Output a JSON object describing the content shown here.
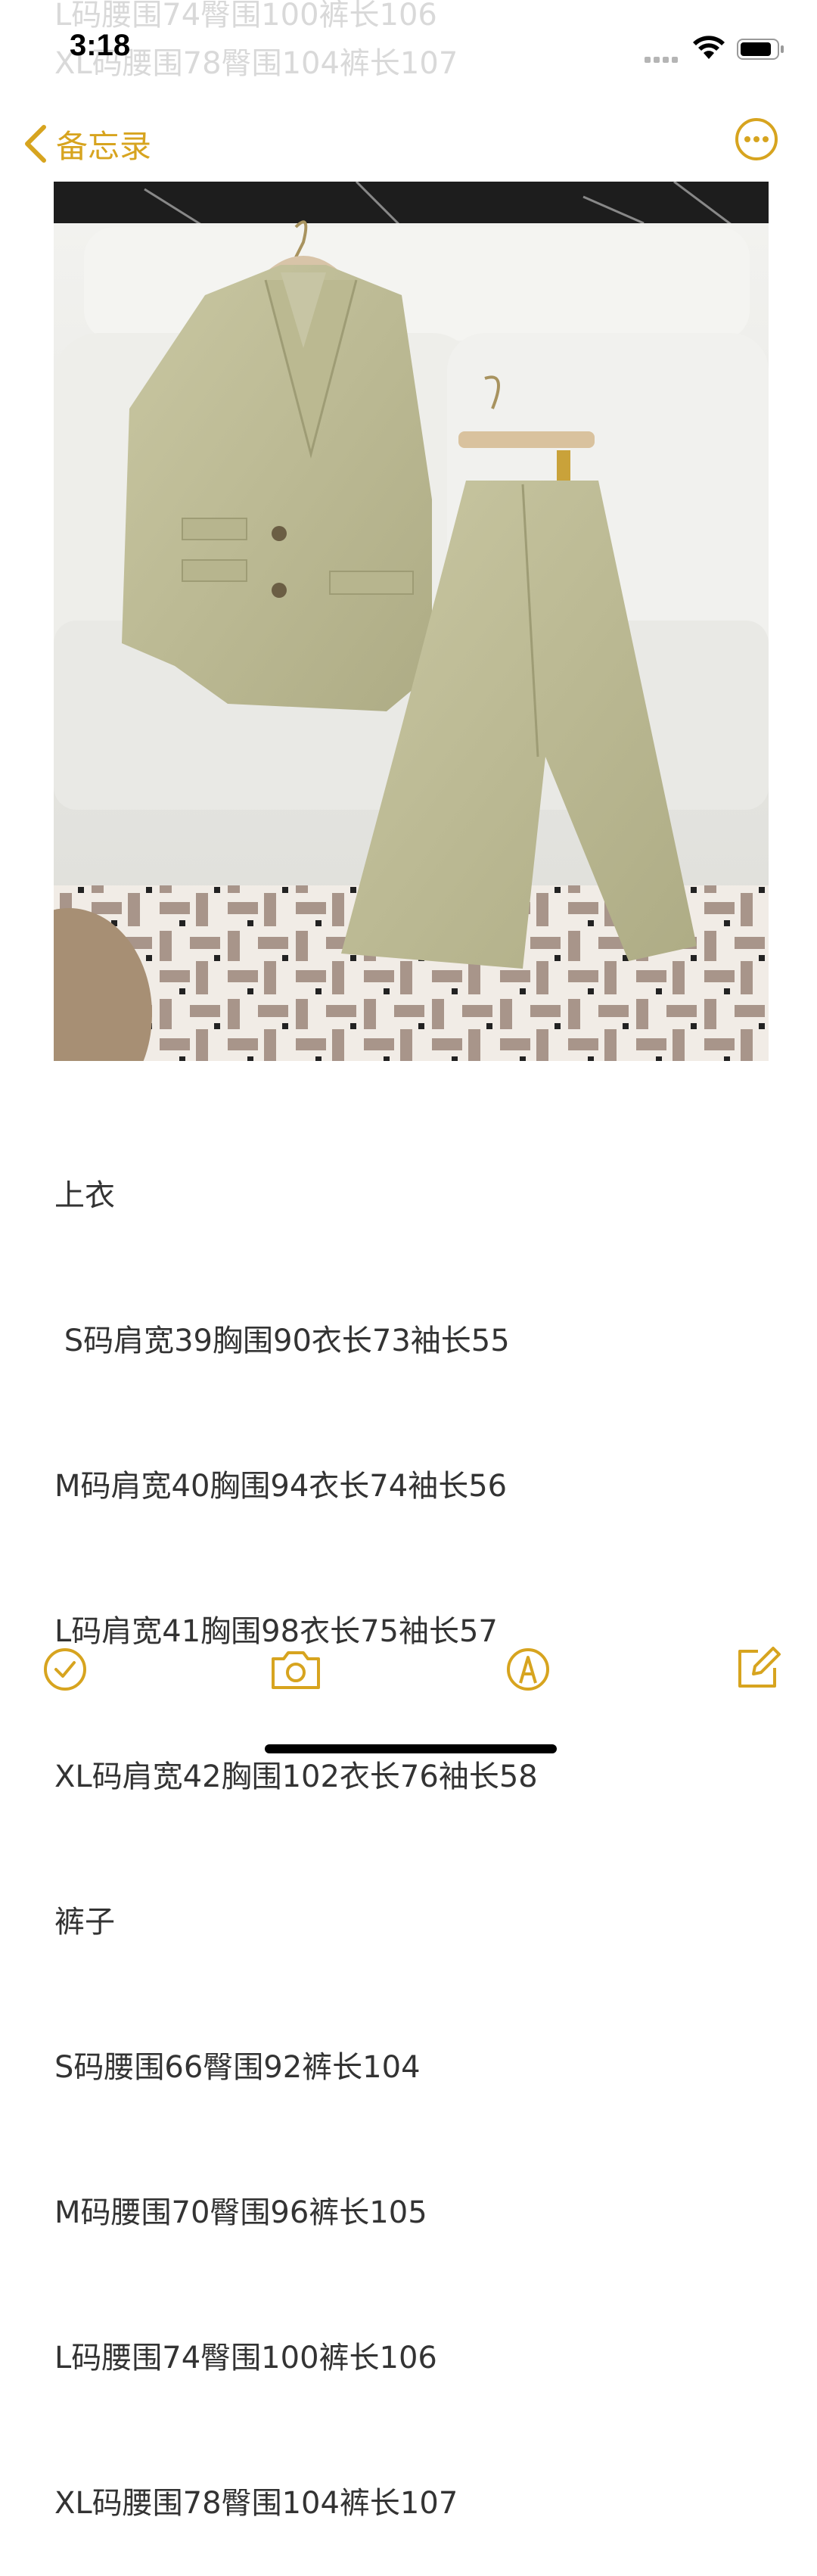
{
  "status_bar": {
    "time": "3:18"
  },
  "ghost_lines": [
    "L码腰围74臀围100裤长106",
    "XL码腰围78臀围104裤长107"
  ],
  "nav": {
    "back_label": "备忘录"
  },
  "note_lines": [
    "上衣",
    " S码肩宽39胸围90衣长73袖长55",
    "M码肩宽40胸围94衣长74袖长56",
    "L码肩宽41胸围98衣长75袖长57",
    "XL码肩宽42胸围102衣长76袖长58",
    "裤子",
    "S码腰围66臀围92裤长104",
    "M码腰围70臀围96裤长105",
    "L码腰围74臀围100裤长106",
    "XL码腰围78臀围104裤长107"
  ],
  "toolbar": {
    "icons": [
      "checklist-icon",
      "camera-icon",
      "markup-pen-icon",
      "compose-icon"
    ]
  },
  "colors": {
    "accent": "#d7a41f",
    "text": "#333333"
  }
}
